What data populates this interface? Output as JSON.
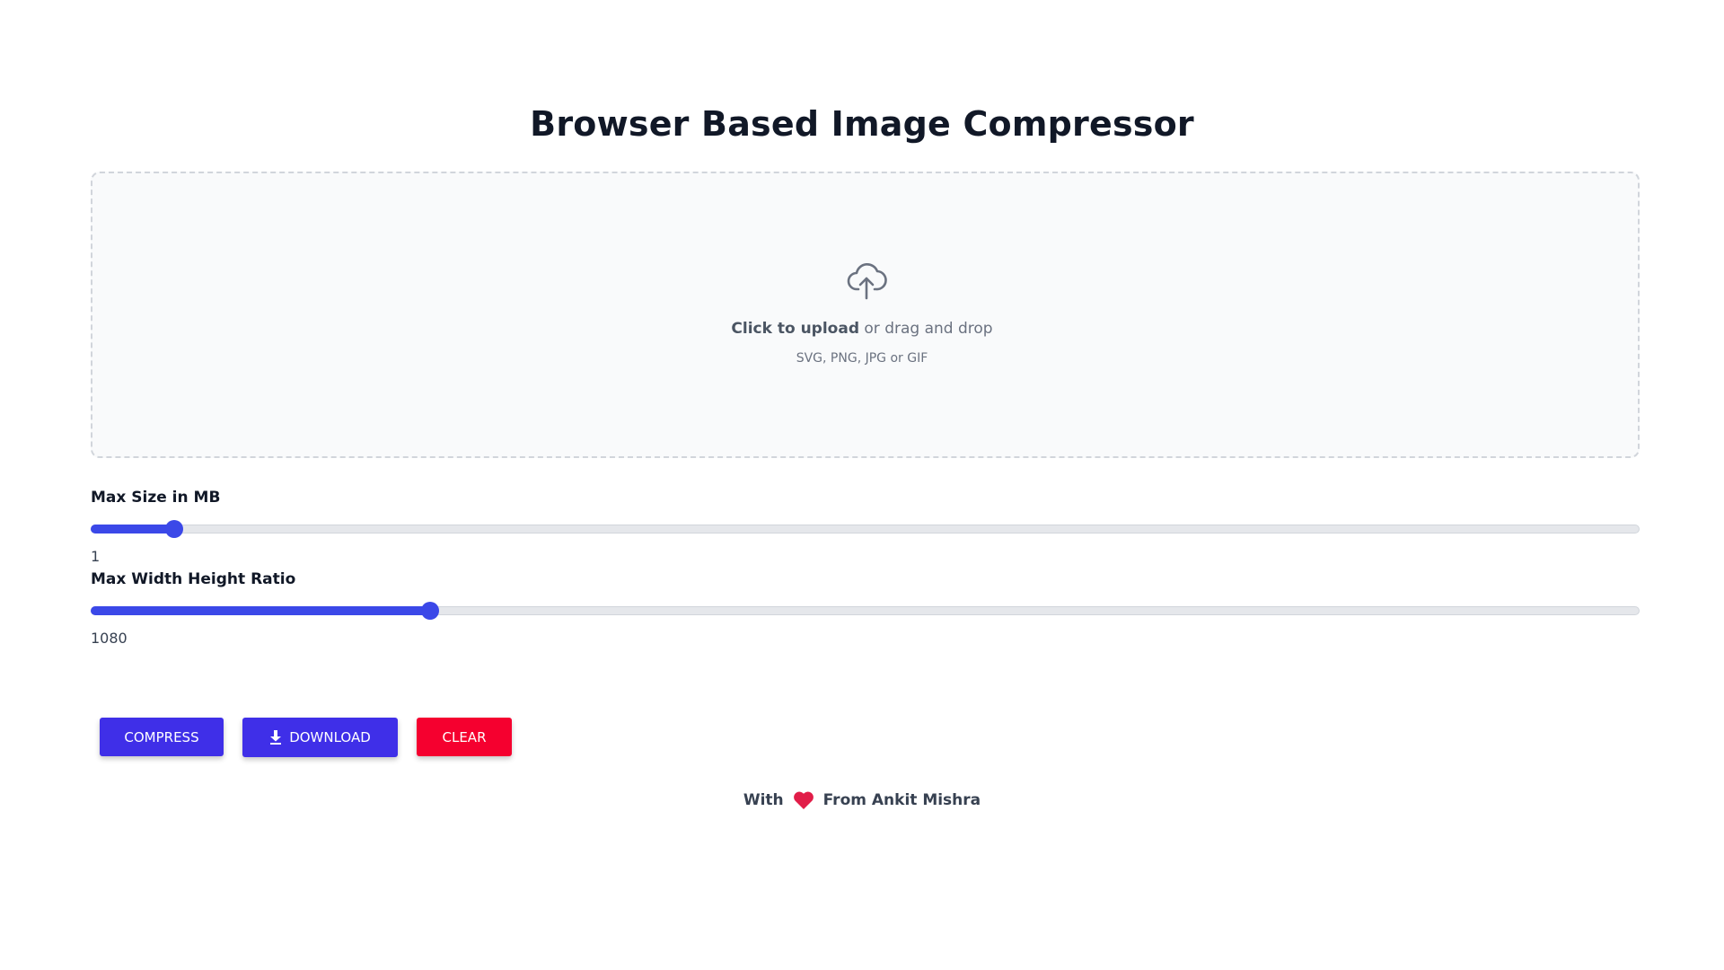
{
  "page": {
    "title": "Browser Based Image Compressor"
  },
  "upload": {
    "icon": "cloud-upload-icon",
    "click_text": "Click to upload",
    "drag_text": "or drag and drop",
    "hint": "SVG, PNG, JPG or GIF"
  },
  "sliders": [
    {
      "label": "Max Size in MB",
      "value": "1",
      "fill_fraction": 0.054
    },
    {
      "label": "Max Width Height Ratio",
      "value": "1080",
      "fill_fraction": 0.219
    }
  ],
  "buttons": {
    "compress": "COMPRESS",
    "download": "DOWNLOAD",
    "download_icon": "download-icon",
    "clear": "CLEAR"
  },
  "footer": {
    "prefix": "With",
    "icon": "heart-icon",
    "suffix": "From Ankit Mishra"
  },
  "colors": {
    "accent": "#3f2fe8",
    "danger": "#f5002f",
    "heart": "#e11d48"
  }
}
